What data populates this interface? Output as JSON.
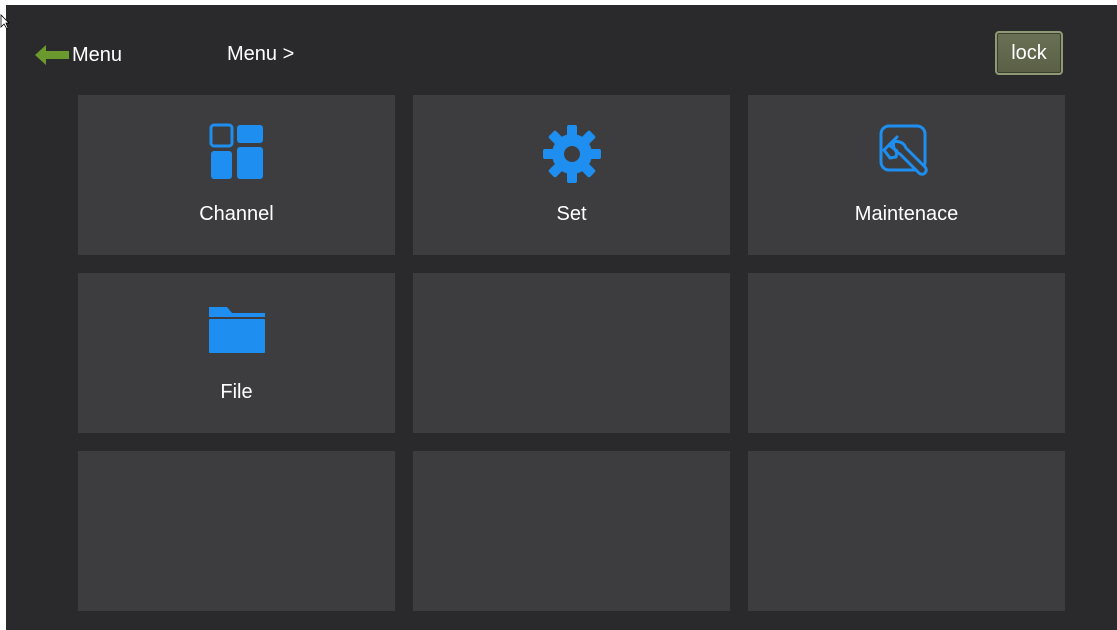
{
  "header": {
    "back_label": "Menu",
    "breadcrumb": "Menu >",
    "lock_label": "lock"
  },
  "tiles": [
    {
      "label": "Channel",
      "icon": "channel-grid-icon"
    },
    {
      "label": "Set",
      "icon": "gear-icon"
    },
    {
      "label": "Maintenace",
      "icon": "wrench-icon"
    },
    {
      "label": "File",
      "icon": "folder-icon"
    },
    {
      "label": "",
      "icon": ""
    },
    {
      "label": "",
      "icon": ""
    },
    {
      "label": "",
      "icon": ""
    },
    {
      "label": "",
      "icon": ""
    },
    {
      "label": "",
      "icon": ""
    }
  ],
  "colors": {
    "background": "#2a2a2c",
    "tile": "#3d3d3f",
    "icon_accent": "#1e8ff0",
    "back_arrow": "#6a9a2e",
    "lock_button": "#5f654b"
  }
}
